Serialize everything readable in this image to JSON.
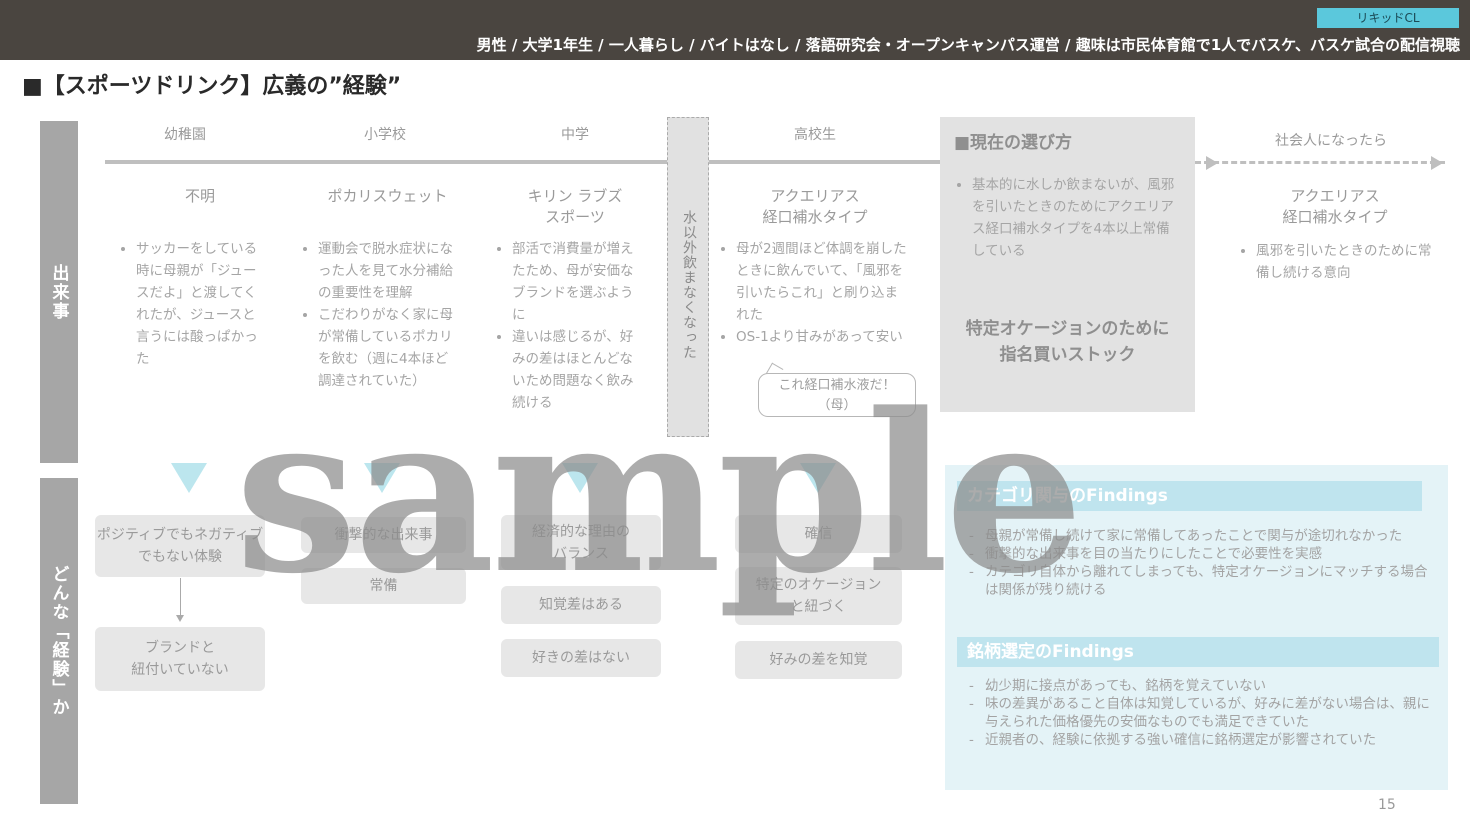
{
  "header": {
    "tag": "リキッドCL",
    "profile": "男性 / 大学1年生 / 一人暮らし / バイトはなし /  落語研究会・オープンキャンパス運営 / 趣味は市民体育館で1人でバスケ、バスケ試合の配信視聴"
  },
  "title": "■【スポーツドリンク】広義の”経験”",
  "sidebar": {
    "events": "出来事",
    "experience": "どんな「経験」か"
  },
  "stages": [
    "幼稚園",
    "小学校",
    "中学",
    "高校生",
    "社会人になったら"
  ],
  "columns": [
    {
      "brand": "不明",
      "bullets": [
        "サッカーをしている時に母親が「ジュースだよ」と渡してくれたが、ジュースと言うには酸っぱかった"
      ]
    },
    {
      "brand": "ポカリスウェット",
      "bullets": [
        "運動会で脱水症状になった人を見て水分補給の重要性を理解",
        "こだわりがなく家に母が常備しているポカリを飲む（週に4本ほど調達されていた）"
      ]
    },
    {
      "brand": "キリン ラブズ\nスポーツ",
      "bullets": [
        "部活で消費量が増えたため、母が安価なブランドを選ぶように",
        "違いは感じるが、好みの差はほとんどないため問題なく飲み続ける"
      ]
    },
    {
      "brand": "アクエリアス\n経口補水タイプ",
      "bullets": [
        "母が2週間ほど体調を崩したときに飲んでいて、「風邪を引いたらこれ」と刷り込まれた",
        "OS-1より甘みがあって安い"
      ]
    }
  ],
  "vertical_note": "水以外飲まなくなった",
  "bubble": "これ経口補水液だ！\n（母）",
  "current": {
    "title": "■現在の選び方",
    "bullets": [
      "基本的に水しか飲まないが、風邪を引いたときのためにアクエリアス経口補水タイプを4本以上常備している"
    ],
    "bold": "特定オケージョンのために\n指名買いストック"
  },
  "future": {
    "brand": "アクエリアス\n経口補水タイプ",
    "bullets": [
      "風邪を引いたときのために常備し続ける意向"
    ]
  },
  "experiences": {
    "kindergarten": [
      "ポジティブでもネガティブでもない体験",
      "ブランドと\n紐付いていない"
    ],
    "elementary": [
      "衝撃的な出来事",
      "常備"
    ],
    "junior_high": [
      "経済的な理由の\nバランス",
      "知覚差はある",
      "好きの差はない"
    ],
    "high_school": [
      "確信",
      "特定のオケージョン\nと紐づく",
      "好みの差を知覚"
    ]
  },
  "findings": {
    "category_title": "カテゴリ関与のFindings",
    "category_items": [
      "母親が常備し続けて家に常備してあったことで関与が途切れなかった",
      "衝撃的な出来事を目の当たりにしたことで必要性を実感",
      "カテゴリ自体から離れてしまっても、特定オケージョンにマッチする場合は関係が残り続ける"
    ],
    "brand_title": "銘柄選定のFindings",
    "brand_items": [
      "幼少期に接点があっても、銘柄を覚えていない",
      "味の差異があること自体は知覚しているが、好みに差がない場合は、親に与えられた価格優先の安価なものでも満足できていた",
      "近親者の、経験に依拠する強い確信に銘柄選定が影響されていた"
    ]
  },
  "watermark": "sample",
  "page_number": "15"
}
